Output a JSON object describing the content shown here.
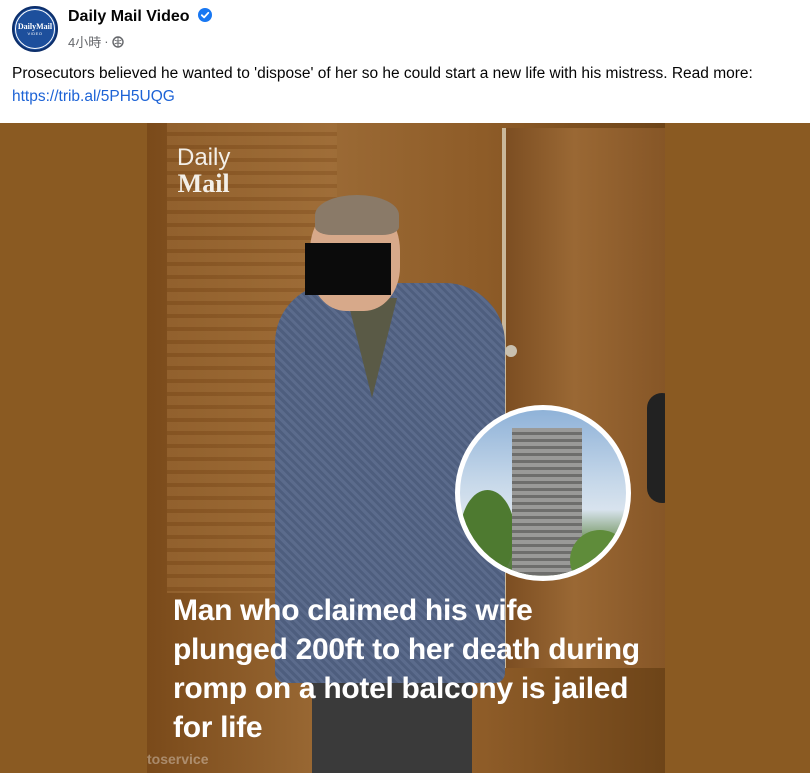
{
  "post": {
    "page_name": "Daily Mail Video",
    "timestamp": "4小時",
    "separator": "·",
    "avatar_text": "DailyMail",
    "avatar_subtext": "VIDEO",
    "caption_text": "Prosecutors believed he wanted to 'dispose' of her so he could start a new life with his mistress. Read more: ",
    "caption_link": "https://trib.al/5PH5UQG"
  },
  "video": {
    "logo_line1": "Daily",
    "logo_line2": "Mail",
    "headline": "Man who claimed his wife plunged 200ft to her death during romp on a hotel balcony is jailed for life",
    "watermark": "toservice"
  },
  "colors": {
    "link": "#1d63d6",
    "verified": "#1877f2",
    "meta_text": "#65676b"
  }
}
